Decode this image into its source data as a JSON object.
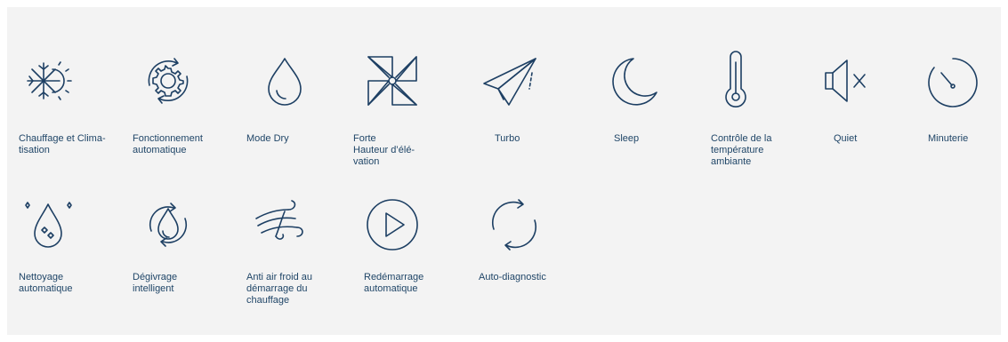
{
  "features": [
    {
      "id": "heat-cool",
      "label": "Chauffage et Clima-\ntisation",
      "icon": "snowflake-sun-icon"
    },
    {
      "id": "auto-op",
      "label": "Fonctionnement\nautomatique",
      "icon": "gear-cycle-icon"
    },
    {
      "id": "dry",
      "label": "Mode Dry",
      "icon": "water-drop-icon"
    },
    {
      "id": "forte",
      "label": "Forte\nHauteur d’élé-\nvation",
      "icon": "pinwheel-icon"
    },
    {
      "id": "turbo",
      "label": "Turbo",
      "icon": "paper-plane-icon"
    },
    {
      "id": "sleep",
      "label": "Sleep",
      "icon": "moon-icon"
    },
    {
      "id": "temp",
      "label": "Contrôle de la\ntempérature\nambiante",
      "icon": "thermometer-icon"
    },
    {
      "id": "quiet",
      "label": "Quiet",
      "icon": "speaker-mute-icon"
    },
    {
      "id": "timer",
      "label": "Minuterie",
      "icon": "timer-icon"
    },
    {
      "id": "self-clean",
      "label": "Nettoyage\nautomatique",
      "icon": "sparkle-drop-icon"
    },
    {
      "id": "defrost",
      "label": "Dégivrage\nintelligent",
      "icon": "drop-cycle-icon"
    },
    {
      "id": "anti-cold",
      "label": "Anti air froid au\ndémarrage du\nchauffage",
      "icon": "wind-icon"
    },
    {
      "id": "auto-restart",
      "label": "Redémarrage\nautomatique",
      "icon": "play-circle-icon"
    },
    {
      "id": "self-diag",
      "label": "Auto-diagnostic",
      "icon": "refresh-cycle-icon"
    }
  ],
  "colors": {
    "background": "#f3f3f3",
    "icon": "#1d3f63",
    "text": "#1f4567"
  }
}
